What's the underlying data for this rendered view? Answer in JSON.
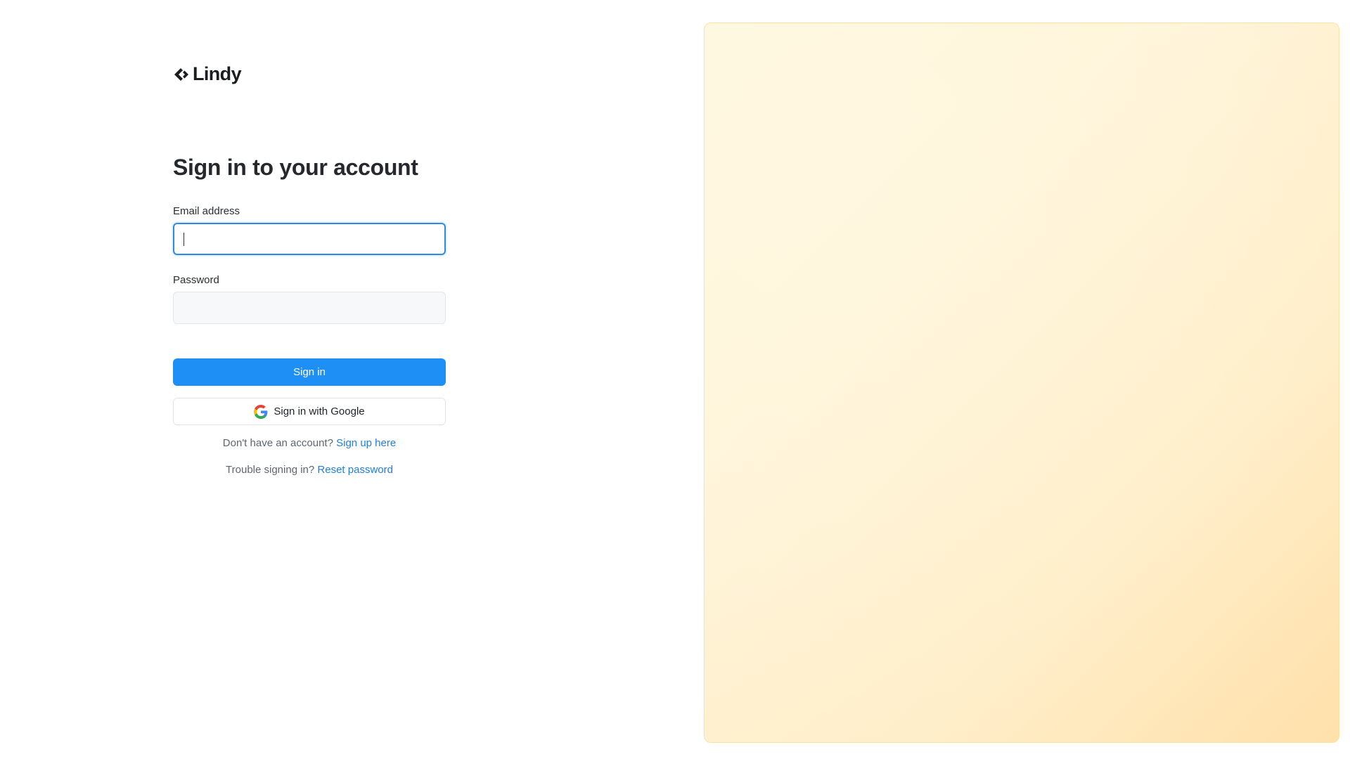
{
  "brand": {
    "name": "Lindy"
  },
  "form": {
    "title": "Sign in to your account",
    "email_label": "Email address",
    "email_value": "",
    "password_label": "Password",
    "password_value": "",
    "sign_in_label": "Sign in",
    "google_label": "Sign in with Google"
  },
  "footer": {
    "signup_prompt": "Don't have an account?",
    "signup_link": "Sign up here",
    "reset_prompt": "Trouble signing in?",
    "reset_link": "Reset password"
  },
  "icons": {
    "logo": "diamond-chevron-icon",
    "google": "google-icon"
  },
  "colors": {
    "primary": "#1e90f5",
    "link": "#1e7fe0",
    "focus_border": "#2f8ae5",
    "panel_border": "#f7e3a0",
    "panel_tint": "#fff3d6"
  }
}
